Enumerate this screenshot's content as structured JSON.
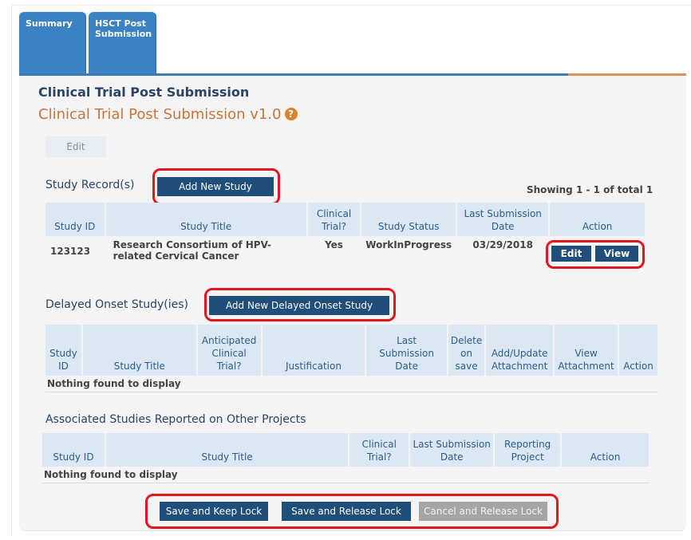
{
  "tabs": {
    "summary": "Summary",
    "hsct_line1": "HSCT Post",
    "hsct_line2": "Submission"
  },
  "header": {
    "title": "Clinical Trial Post Submission",
    "subtitle": "Clinical Trial Post Submission v1.0",
    "help_glyph": "?"
  },
  "edit_label": "Edit",
  "study_records": {
    "label": "Study Record(s)",
    "add_button": "Add New Study",
    "showing": "Showing 1 - 1 of total 1",
    "columns": [
      "Study ID",
      "Study Title",
      "Clinical Trial?",
      "Study Status",
      "Last Submission Date",
      "Action"
    ],
    "rows": [
      {
        "id": "123123",
        "title": "Research Consortium of HPV-related Cervical Cancer",
        "clinical": "Yes",
        "status": "WorkInProgress",
        "date": "03/29/2018",
        "edit": "Edit",
        "view": "View"
      }
    ]
  },
  "delayed": {
    "label": "Delayed Onset Study(ies)",
    "add_button": "Add New Delayed Onset Study",
    "columns": [
      "Study ID",
      "Study Title",
      "Anticipated Clinical Trial?",
      "Justification",
      "Last Submission Date",
      "Delete on save",
      "Add/Update Attachment",
      "View Attachment",
      "Action"
    ],
    "empty": "Nothing found to display"
  },
  "associated": {
    "label": "Associated Studies Reported on Other Projects",
    "columns": [
      "Study ID",
      "Study Title",
      "Clinical Trial?",
      "Last Submission Date",
      "Reporting Project",
      "Action"
    ],
    "empty": "Nothing found to display"
  },
  "footer": {
    "save_keep": "Save and Keep Lock",
    "save_release": "Save and Release Lock",
    "cancel_release": "Cancel and Release Lock"
  },
  "colors": {
    "tab": "#3b82c4",
    "button": "#1f4e7a",
    "header_cell": "#dbe7f3",
    "accent_orange": "#c8743c",
    "highlight_red": "#e2161d"
  }
}
